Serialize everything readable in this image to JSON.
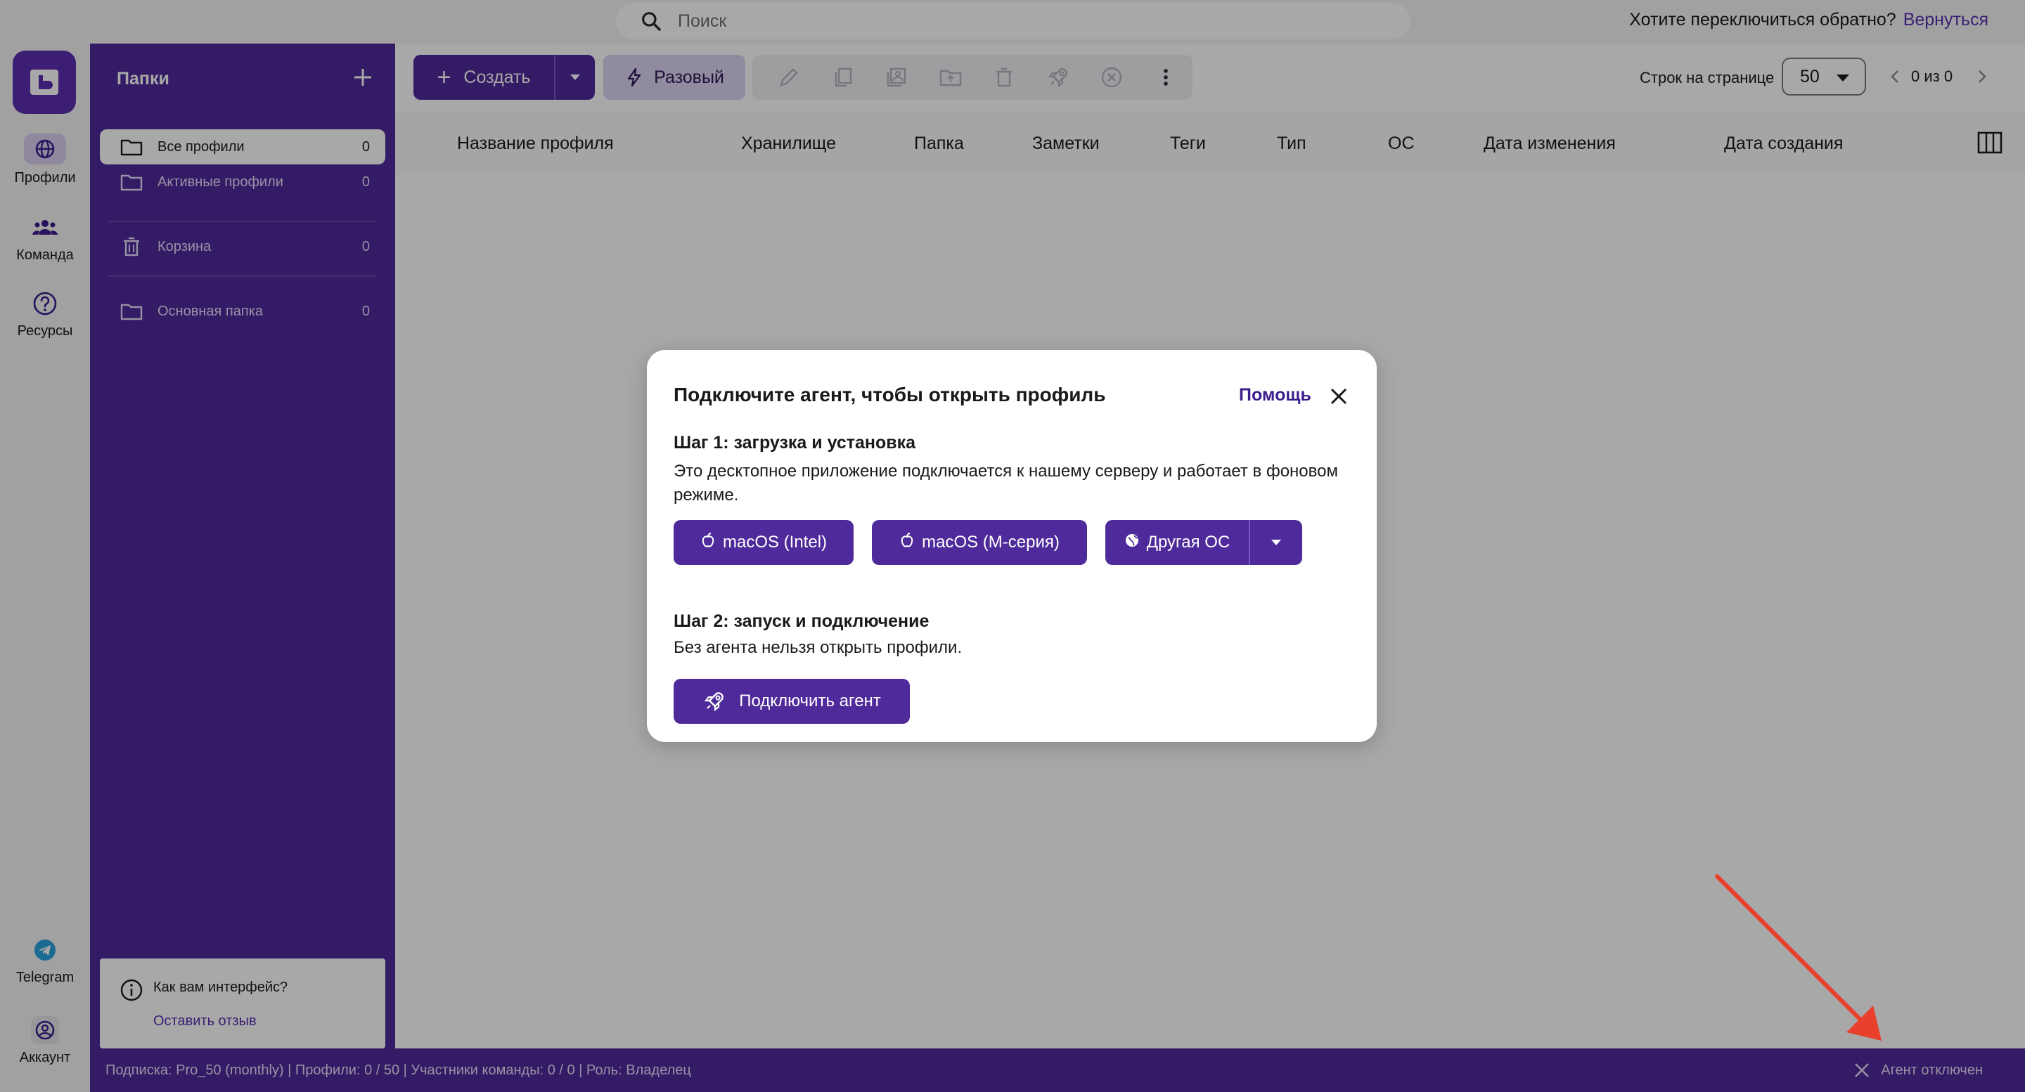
{
  "topbar": {
    "search_placeholder": "Поиск",
    "switch_question": "Хотите переключиться обратно?",
    "switch_link": "Вернуться"
  },
  "rail": {
    "items": [
      {
        "label": "Профили",
        "icon": "globe-icon"
      },
      {
        "label": "Команда",
        "icon": "team-icon"
      },
      {
        "label": "Ресурсы",
        "icon": "help-circle-icon"
      },
      {
        "label": "Telegram",
        "icon": "telegram-icon"
      },
      {
        "label": "Аккаунт",
        "icon": "account-icon"
      }
    ]
  },
  "folders": {
    "title": "Папки",
    "items": [
      {
        "label": "Все профили",
        "count": "0"
      },
      {
        "label": "Активные профили",
        "count": "0"
      },
      {
        "label": "Корзина",
        "count": "0"
      },
      {
        "label": "Основная папка",
        "count": "0"
      }
    ],
    "feedback_question": "Как вам интерфейс?",
    "feedback_link": "Оставить отзыв"
  },
  "toolbar": {
    "create_label": "Создать",
    "oneoff_label": "Разовый",
    "rows_label": "Строк на странице",
    "rows_value": "50",
    "pager_text": "0 из 0"
  },
  "table": {
    "columns": [
      "Название профиля",
      "Хранилище",
      "Папка",
      "Заметки",
      "Теги",
      "Тип",
      "ОС",
      "Дата изменения",
      "Дата создания"
    ]
  },
  "statusbar": {
    "text": "Подписка: Pro_50 (monthly) |  Профили: 0 / 50 |  Участники команды: 0 / 0 |  Роль: Владелец",
    "agent_status": "Агент отключен"
  },
  "modal": {
    "title": "Подключите агент, чтобы открыть профиль",
    "help": "Помощь",
    "step1_title": "Шаг 1: загрузка и установка",
    "step1_desc": "Это десктопное приложение подключается к нашему серверу и работает в фоновом режиме.",
    "btn_mac_intel": "macOS (Intel)",
    "btn_mac_m": "macOS (M-серия)",
    "btn_other_os": "Другая ОС",
    "step2_title": "Шаг 2: запуск и подключение",
    "step2_desc": "Без агента нельзя открыть профили.",
    "connect_label": "Подключить агент"
  },
  "colors": {
    "accent": "#4e2a9a",
    "link": "#5b2fb0",
    "annotation": "#e8402a"
  }
}
